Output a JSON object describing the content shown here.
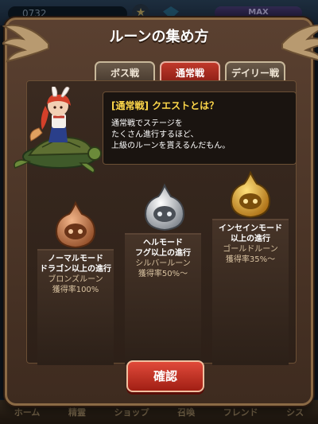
{
  "background": {
    "counter": "0732",
    "max_label": "MAX",
    "nav": [
      "ホーム",
      "精霊",
      "ショップ",
      "召喚",
      "フレンド",
      "シス"
    ]
  },
  "dialog": {
    "title": "ルーンの集め方",
    "tabs": [
      {
        "label": "ボス戦",
        "active": false
      },
      {
        "label": "通常戦",
        "active": true
      },
      {
        "label": "デイリー戦",
        "active": false
      }
    ],
    "info": {
      "title": "[通常戦] クエストとは？",
      "lines": [
        "通常戦でステージを",
        "たくさん進行するほど、",
        "上級のルーンを貰えるんだもん。"
      ]
    },
    "tiers": [
      {
        "mode": "ノーマルモード",
        "condition": "ドラゴン以上の進行",
        "rune": "ブロンズルーン",
        "rate": "獲得率100%",
        "color": "#c77a4a"
      },
      {
        "mode": "ヘルモード",
        "condition": "フグ以上の進行",
        "rune": "シルバールーン",
        "rate": "獲得率50%～",
        "color": "#b8bcc4"
      },
      {
        "mode": "インセインモード",
        "condition": "以上の進行",
        "rune": "ゴールドルーン",
        "rate": "獲得率35%～",
        "color": "#e2a326"
      }
    ],
    "confirm_label": "確認"
  }
}
